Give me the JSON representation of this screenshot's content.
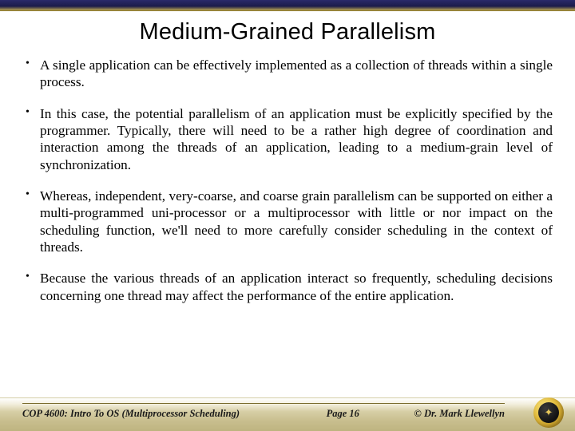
{
  "title": "Medium-Grained Parallelism",
  "bullets": [
    "A single application can be effectively implemented as a collection of threads within a single process.",
    "In this case, the potential parallelism of an application must be explicitly specified by the programmer.  Typically, there will need to be a rather high degree of coordination and interaction among the threads of an application, leading to a medium-grain level of synchronization.",
    "Whereas, independent, very-coarse, and coarse grain parallelism can be supported on either a multi-programmed uni-processor or a multiprocessor with little or nor impact on the scheduling function, we'll need to more carefully consider scheduling in the context of threads.",
    "Because the various threads of an application interact so frequently, scheduling decisions concerning one thread may affect the performance of the entire application."
  ],
  "footer": {
    "course": "COP 4600: Intro To OS  (Multiprocessor Scheduling)",
    "page": "Page 16",
    "author": "© Dr. Mark Llewellyn"
  }
}
